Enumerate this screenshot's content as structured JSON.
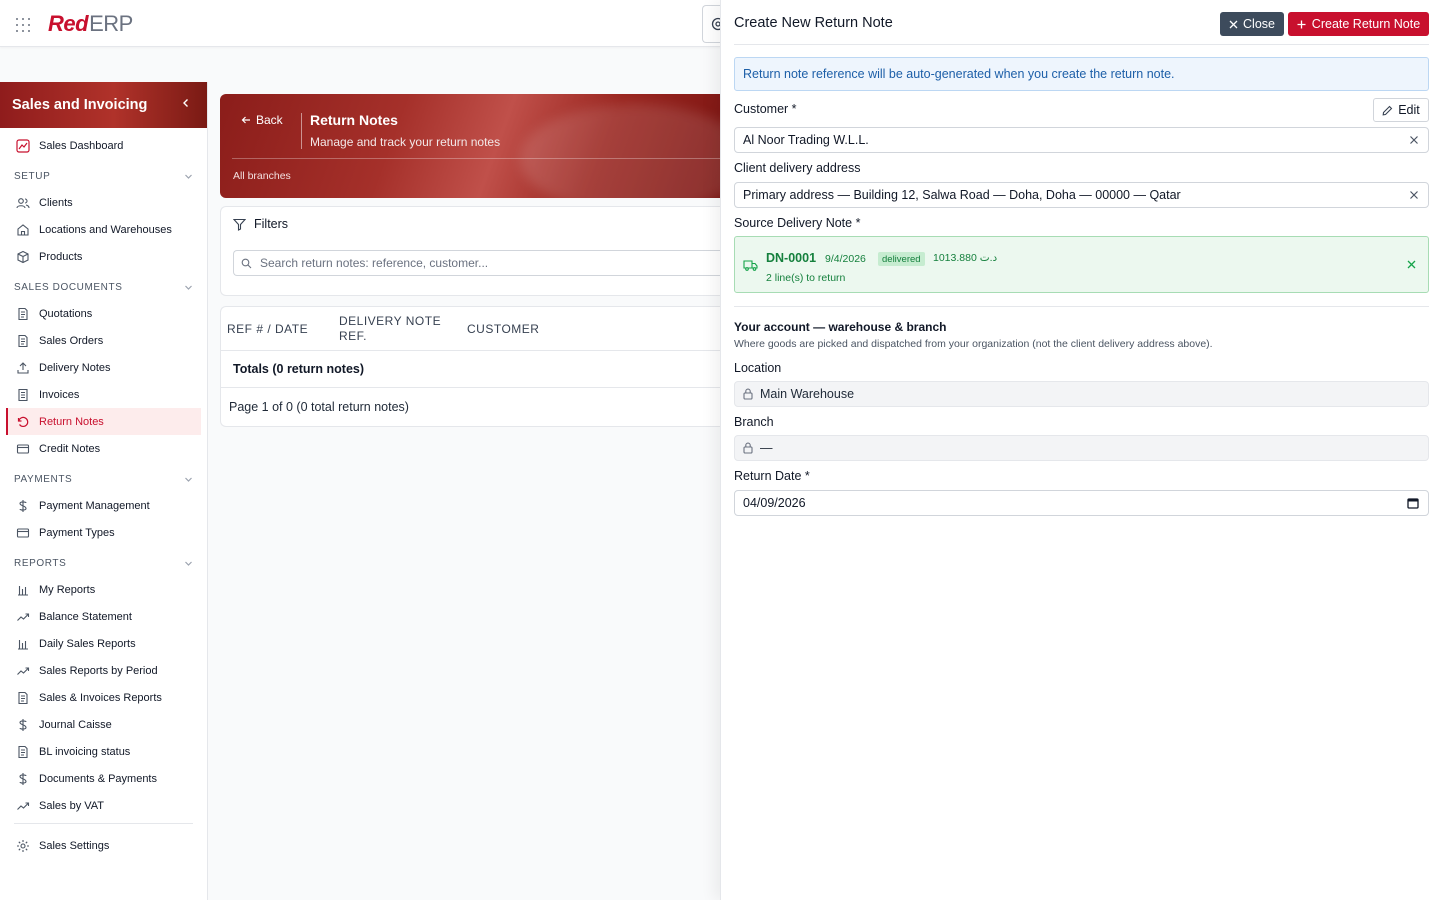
{
  "header": {
    "logo_red": "Red",
    "logo_erp": "ERP"
  },
  "sidebar": {
    "title": "Sales and Invoicing",
    "dashboard": "Sales Dashboard",
    "sections": {
      "setup": "SETUP",
      "sales_documents": "SALES DOCUMENTS",
      "payments": "PAYMENTS",
      "reports": "REPORTS"
    },
    "setup_items": [
      "Clients",
      "Locations and Warehouses",
      "Products"
    ],
    "sales_items": [
      "Quotations",
      "Sales Orders",
      "Delivery Notes",
      "Invoices",
      "Return Notes",
      "Credit Notes"
    ],
    "payment_items": [
      "Payment Management",
      "Payment Types"
    ],
    "report_items": [
      "My Reports",
      "Balance Statement",
      "Daily Sales Reports",
      "Sales Reports by Period",
      "Sales & Invoices Reports",
      "Journal Caisse",
      "BL invoicing status",
      "Documents & Payments",
      "Sales by VAT"
    ],
    "settings": "Sales Settings",
    "active_item": "Return Notes"
  },
  "page": {
    "back_label": "Back",
    "title": "Return Notes",
    "subtitle": "Manage and track your return notes",
    "branch_scope": "All branches",
    "filters_title": "Filters",
    "search_placeholder": "Search return notes: reference, customer...",
    "table": {
      "col_ref": "REF # / DATE",
      "col_dn_line1": "DELIVERY NOTE",
      "col_dn_line2": "REF.",
      "col_customer": "CUSTOMER",
      "totals": "Totals (0 return notes)",
      "pagination": "Page 1 of 0 (0 total return notes)"
    }
  },
  "drawer": {
    "title": "Create New Return Note",
    "close_label": "Close",
    "create_label": "Create Return Note",
    "info": "Return note reference will be auto-generated when you create the return note.",
    "customer_label": "Customer *",
    "edit_label": "Edit",
    "customer_value": "Al Noor Trading W.L.L.",
    "address_label": "Client delivery address",
    "address_value": "Primary address — Building 12, Salwa Road — Doha, Doha — 00000 — Qatar",
    "source_label": "Source Delivery Note *",
    "source": {
      "ref": "DN-0001",
      "date": "9/4/2026",
      "status": "delivered",
      "amount": "1013.880 د.ت",
      "lines": "2 line(s) to return"
    },
    "account_title": "Your account — warehouse & branch",
    "account_sub": "Where goods are picked and dispatched from your organization (not the client delivery address above).",
    "location_label": "Location",
    "location_value": "Main Warehouse",
    "branch_label": "Branch",
    "branch_value": "—",
    "return_date_label": "Return Date *",
    "return_date_value": "04/09/2026"
  },
  "colors": {
    "brand": "#c8102e",
    "close_button": "#3d4b5c",
    "info_bg": "#eef5fd",
    "success": "#15803d"
  }
}
